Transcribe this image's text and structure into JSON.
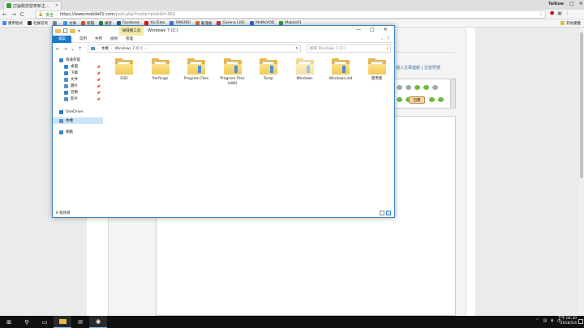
{
  "browser": {
    "tab_title": "討論刪您發表新主題的...",
    "tab_close": "×",
    "user_label": "TaiKoo",
    "window_controls": [
      "—",
      "□",
      "✕"
    ],
    "nav": [
      "←",
      "→",
      "C"
    ],
    "secure_label": "安全",
    "url_host": "https://www.mobile01.com",
    "url_path": "/post.php?mode=post&f=300",
    "bookmarks": [
      {
        "label": "應用程式",
        "color": "#4285f4"
      },
      {
        "label": "社群首頁",
        "color": "#333333"
      },
      {
        "label": "",
        "color": "#888888"
      },
      {
        "label": "文章",
        "color": "#4aa3df"
      },
      {
        "label": "新聞",
        "color": "#e05a2b"
      },
      {
        "label": "播客",
        "color": "#2b8a3e"
      },
      {
        "label": "Facebook",
        "color": "#3b5998"
      },
      {
        "label": "YouTube",
        "color": "#ff0000"
      },
      {
        "label": "99KUBO",
        "color": "#3c7be0"
      },
      {
        "label": "動漫瘋",
        "color": "#e0701e"
      },
      {
        "label": "Garena LIVE",
        "color": "#d23a2a"
      },
      {
        "label": "MoMoVOD",
        "color": "#2b6bd6"
      },
      {
        "label": "Mobile01",
        "color": "#3c9a3c"
      }
    ],
    "other_bookmarks": "其他書籤"
  },
  "webpage": {
    "links_text": "插入文章連結 | 注音符號",
    "reply_button": "回覆"
  },
  "explorer": {
    "title": "Windows 7 (C:)",
    "context_tab": "磁碟機工具",
    "controls": [
      "—",
      "□",
      "✕"
    ],
    "ribbon_tabs": [
      "檔案",
      "常用",
      "共用",
      "檢視",
      "管理"
    ],
    "nav_arrows": [
      "←",
      "→",
      "⌄",
      "↑"
    ],
    "breadcrumb": [
      "本機",
      "›",
      "Windows 7 (C:)",
      "›"
    ],
    "search_placeholder": "搜尋 Windows 7 (C:)",
    "sidebar": [
      {
        "label": "快速存取",
        "color": "#3a84c7",
        "pinned": false
      },
      {
        "label": "桌面",
        "color": "#3a84c7",
        "pinned": true
      },
      {
        "label": "下載",
        "color": "#3a84c7",
        "pinned": true
      },
      {
        "label": "文件",
        "color": "#5a8fc6",
        "pinned": true
      },
      {
        "label": "圖片",
        "color": "#5a8fc6",
        "pinned": true
      },
      {
        "label": "音樂",
        "color": "#3a84c7",
        "pinned": true
      },
      {
        "label": "影片",
        "color": "#5a8fc6",
        "pinned": true
      },
      {
        "label": "OneDrive",
        "color": "#1e78d6",
        "pinned": false
      },
      {
        "label": "本機",
        "color": "#5a8fc6",
        "pinned": false
      },
      {
        "label": "網路",
        "color": "#3a84c7",
        "pinned": false
      }
    ],
    "folders": [
      {
        "label": "ESD",
        "faded": false
      },
      {
        "label": "PerfLogs",
        "faded": false
      },
      {
        "label": "Program Files",
        "faded": false
      },
      {
        "label": "Program Files (x86)",
        "faded": false
      },
      {
        "label": "Temp",
        "faded": false
      },
      {
        "label": "Windows",
        "faded": true
      },
      {
        "label": "Windows.old",
        "faded": false
      },
      {
        "label": "使用者",
        "faded": false
      }
    ],
    "status": "8 個項目"
  },
  "taskbar": {
    "time": "下午 04:30",
    "date": "2018/5/4"
  }
}
